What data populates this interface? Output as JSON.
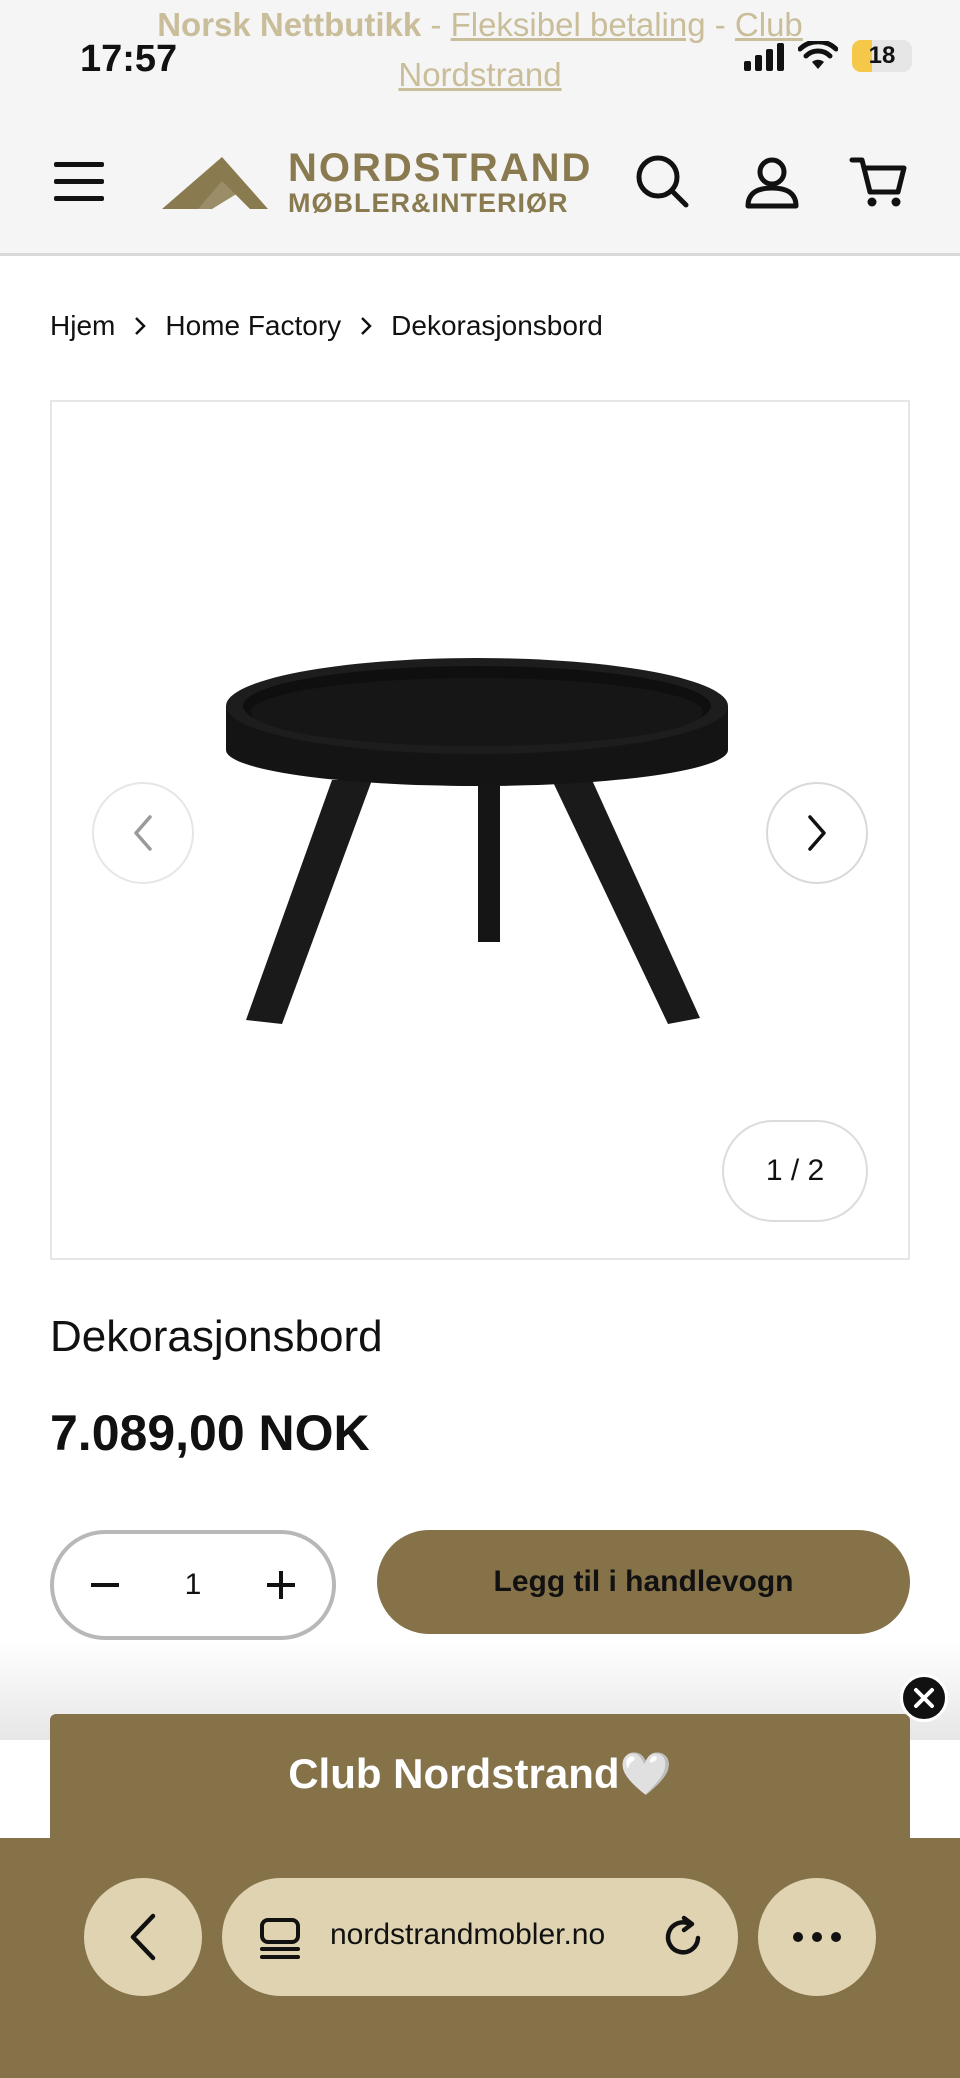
{
  "status_bar": {
    "time": "17:57",
    "battery": "18",
    "icons": [
      "signal-icon",
      "wifi-icon",
      "battery-icon"
    ]
  },
  "announcement": {
    "brand": "Norsk Nettbutikk",
    "sep1": " - ",
    "link1": "Fleksibel betaling",
    "sep2": " - ",
    "link2": "Club Nordstrand"
  },
  "header": {
    "logo_line1": "NORDSTRAND",
    "logo_line2": "MØBLER&INTERIØR",
    "icons": [
      "menu-icon",
      "search-icon",
      "account-icon",
      "cart-icon"
    ]
  },
  "breadcrumb": [
    "Hjem",
    "Home Factory",
    "Dekorasjonsbord"
  ],
  "gallery": {
    "counter": "1 / 2"
  },
  "product": {
    "title": "Dekorasjonsbord",
    "price": "7.089,00 NOK",
    "quantity": "1",
    "add_to_cart": "Legg til i handlevogn"
  },
  "club_banner": {
    "title": "Club Nordstrand🤍"
  },
  "browser": {
    "url": "nordstrandmobler.no"
  },
  "colors": {
    "accent": "#857249",
    "accent_light": "#dfd3b2",
    "announcement_text": "#c9bd9a"
  }
}
